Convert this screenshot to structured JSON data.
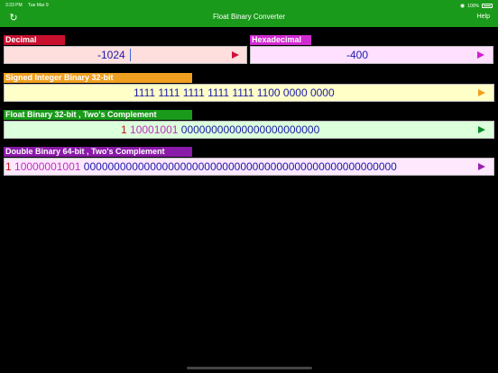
{
  "status": {
    "time": "3:33 PM",
    "date": "Tue Mar 9",
    "battery": "100%",
    "wifi_icon": "wifi-icon",
    "battery_icon": "battery-icon"
  },
  "nav": {
    "title": "Float Binary Converter",
    "help": "Help",
    "refresh_icon": "refresh-icon"
  },
  "decimal": {
    "label": "Decimal",
    "value": "-1024",
    "label_color": "#c8102e",
    "field_color": "#ffdede",
    "arrow_color": "#d0103a"
  },
  "hex": {
    "label": "Hexadecimal",
    "value": "-400",
    "label_color": "#d02bd0",
    "field_color": "#ffe0ff",
    "arrow_color": "#d020d0"
  },
  "int32": {
    "label": "Signed Integer Binary 32-bit",
    "value": "1111 1111 1111 1111 1111 1100 0000 0000",
    "label_color": "#f0a020",
    "field_color": "#ffffc8",
    "arrow_color": "#f0a020"
  },
  "float32": {
    "label": "Float Binary 32-bit , Two's Complement",
    "sign": "1",
    "exponent": "10001001",
    "mantissa": "00000000000000000000000",
    "label_color": "#1a9a1a",
    "field_color": "#dcffdc",
    "arrow_color": "#0a8a2a"
  },
  "double64": {
    "label": "Double Binary 64-bit , Two's Complement",
    "sign": "1",
    "exponent": "10000001001",
    "mantissa": "0000000000000000000000000000000000000000000000000000",
    "label_color": "#8a1aa8",
    "field_color": "#fde8fd",
    "arrow_color": "#9a20b0"
  },
  "colors": {
    "sign": "#c81414",
    "exponent": "#c030c0",
    "mantissa": "#1a1aa8"
  }
}
